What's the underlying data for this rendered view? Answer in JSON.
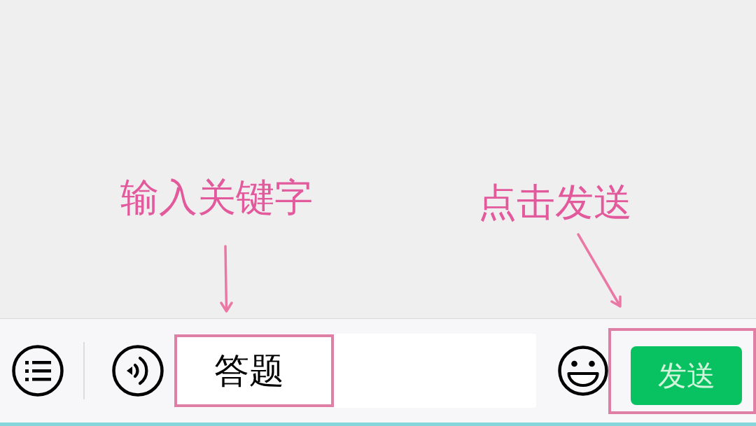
{
  "input_bar": {
    "message_field": {
      "value": "答题",
      "highlighted": true,
      "callout": "输入关键字"
    },
    "send_button": {
      "label": "发送",
      "highlighted": true,
      "callout": "点击发送"
    }
  }
}
